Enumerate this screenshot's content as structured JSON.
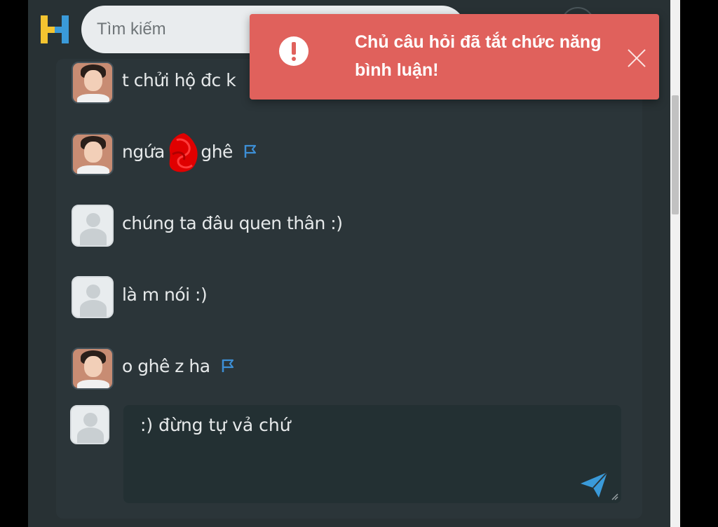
{
  "header": {
    "search_placeholder": "Tìm kiếm",
    "logo_letter": "H"
  },
  "comments": [
    {
      "text": "t chửi hộ đc k",
      "avatar": "photo",
      "flag": false
    },
    {
      "text_before": "ngứa",
      "text_after": " ghê",
      "avatar": "photo",
      "flag": true
    },
    {
      "text": "chúng ta đâu quen thân :)",
      "avatar": "default",
      "flag": false
    },
    {
      "text": "là m nói :)",
      "avatar": "default",
      "flag": false
    },
    {
      "text": "o ghê z ha",
      "avatar": "photo",
      "flag": true
    }
  ],
  "reply": {
    "value": ":) đừng tự vả chứ"
  },
  "toast": {
    "message": "Chủ câu hỏi đã tắt chức năng bình luận!",
    "type": "error"
  },
  "colors": {
    "page_bg": "#283134",
    "panel_bg": "#2b3539",
    "toast_bg": "#e0615c",
    "flag_blue": "#3d8fd6",
    "logo_yellow": "#f4c430",
    "logo_blue": "#3a9ad9"
  },
  "icons": [
    "logo-icon",
    "report-flag-icon",
    "send-icon",
    "alert-icon",
    "close-icon"
  ]
}
